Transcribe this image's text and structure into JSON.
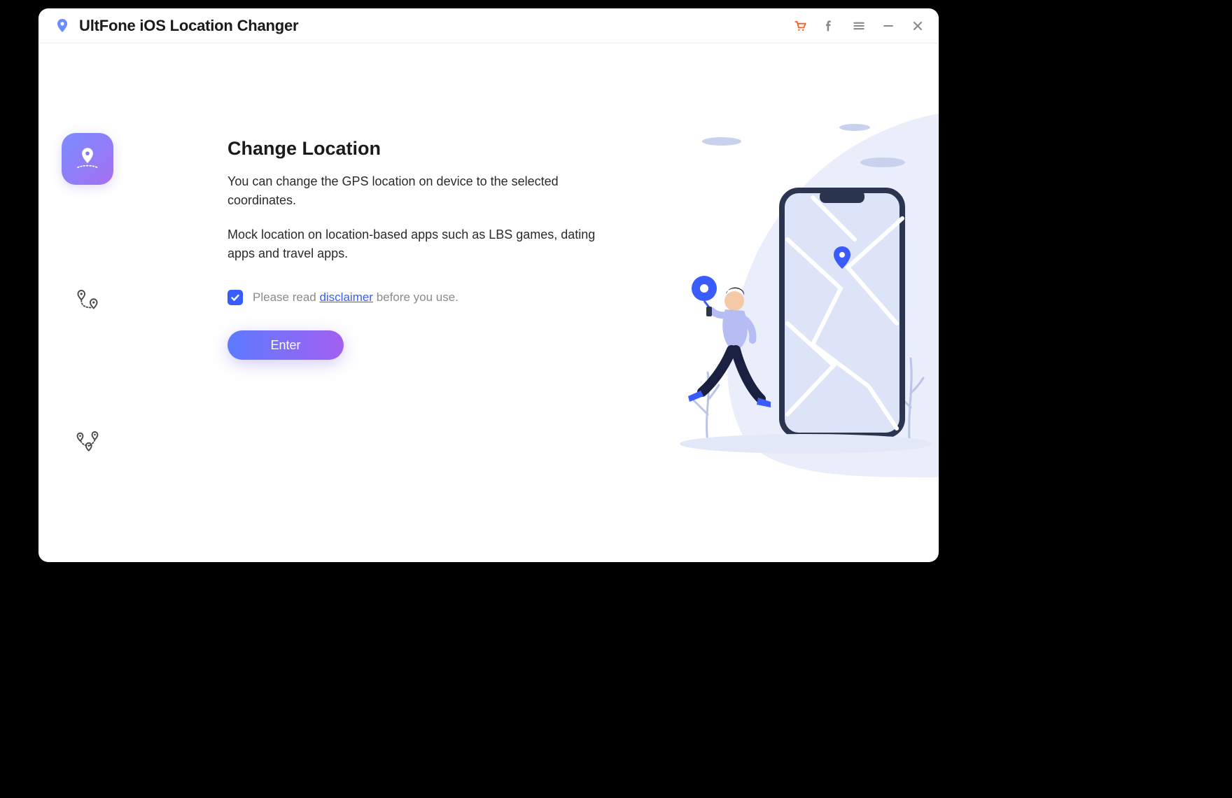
{
  "app": {
    "title": "UltFone iOS Location Changer"
  },
  "sidebar": {
    "items": [
      {
        "name": "change-location",
        "active": true
      },
      {
        "name": "single-spot-movement",
        "active": false
      },
      {
        "name": "multi-spot-movement",
        "active": false
      }
    ]
  },
  "main": {
    "heading": "Change Location",
    "desc1": "You can change the GPS location on device to the selected coordinates.",
    "desc2": "Mock location on location-based apps such as LBS games, dating apps and travel apps.",
    "disclaimer_prefix": "Please read ",
    "disclaimer_link": "disclaimer",
    "disclaimer_suffix": " before you use.",
    "disclaimer_checked": true,
    "enter_label": "Enter"
  },
  "colors": {
    "accent_blue": "#375cff",
    "gradient_start": "#5d7bff",
    "gradient_end": "#a360f0",
    "cart": "#ff5a1f"
  }
}
